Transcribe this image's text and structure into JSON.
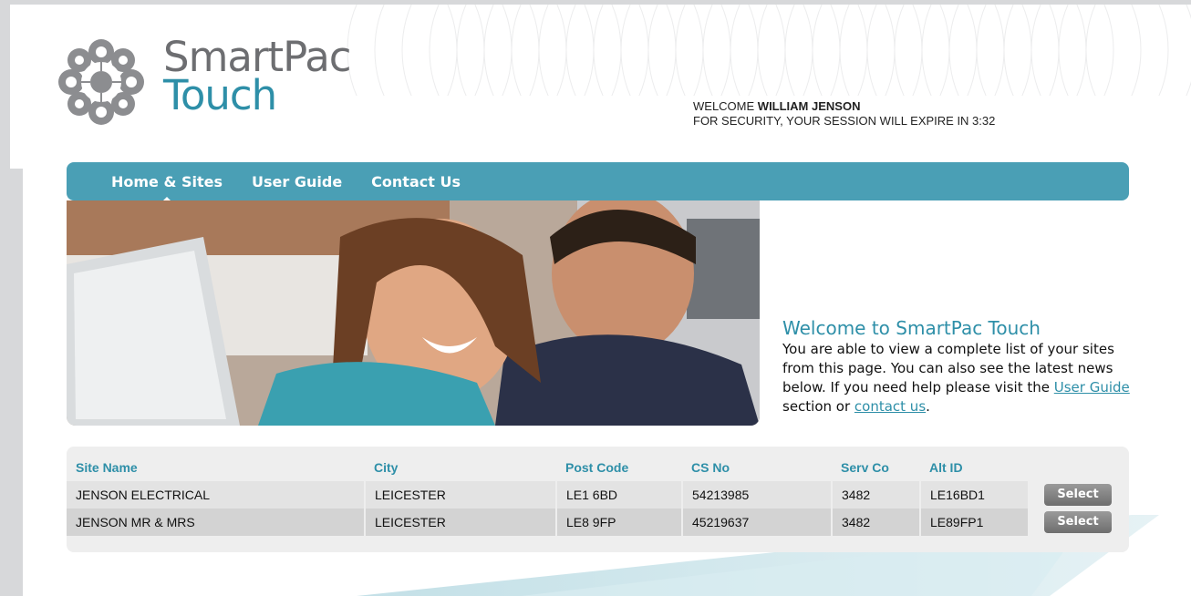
{
  "brand": {
    "line1": "SmartPac",
    "line2": "Touch"
  },
  "welcome": {
    "prefix": "WELCOME ",
    "user": "WILLIAM JENSON",
    "session_msg": "FOR SECURITY, YOUR SESSION WILL EXPIRE IN 3:32"
  },
  "nav": {
    "items": [
      {
        "label": "Home & Sites"
      },
      {
        "label": "User Guide"
      },
      {
        "label": "Contact Us"
      }
    ]
  },
  "intro": {
    "title": "Welcome to SmartPac Touch",
    "body_1": "You are able to view a complete list of your sites from this page. You can also see the latest news below.  If you need help please visit the ",
    "link_user_guide": "User Guide",
    "body_2": "  section or ",
    "link_contact": "contact us",
    "body_3": "."
  },
  "sites_table": {
    "columns": [
      "Site Name",
      "City",
      "Post Code",
      "CS No",
      "Serv Co",
      "Alt ID"
    ],
    "rows": [
      {
        "site_name": "JENSON ELECTRICAL",
        "city": "LEICESTER",
        "post_code": "LE1 6BD",
        "cs_no": "54213985",
        "serv_co": "3482",
        "alt_id": "LE16BD1",
        "action": "Select"
      },
      {
        "site_name": "JENSON MR & MRS",
        "city": "LEICESTER",
        "post_code": "LE8 9FP",
        "cs_no": "45219637",
        "serv_co": "3482",
        "alt_id": "LE89FP1",
        "action": "Select"
      }
    ]
  },
  "colors": {
    "accent": "#4a9fb5",
    "brand_teal": "#2e8fa8",
    "brand_grey": "#6d6e71"
  }
}
